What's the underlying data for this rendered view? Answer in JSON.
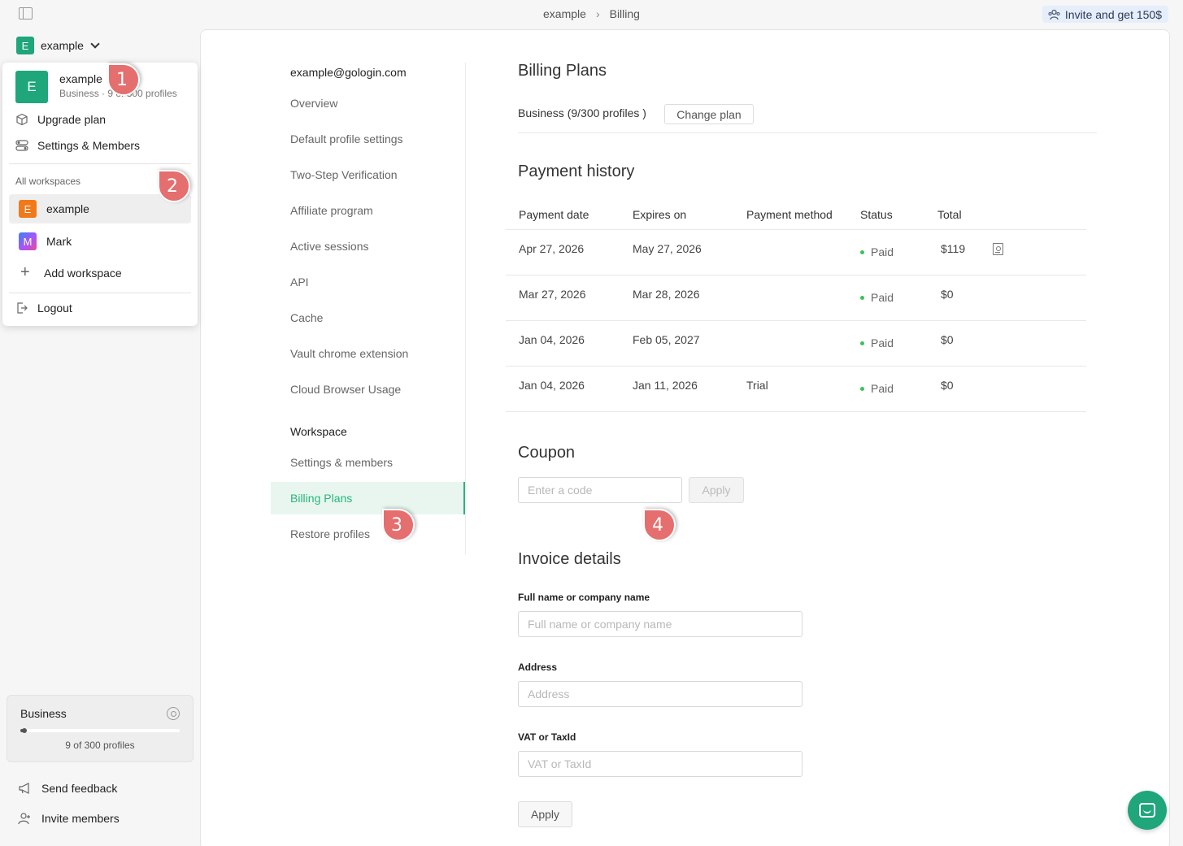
{
  "topbar": {
    "breadcrumb": [
      "example",
      "Billing"
    ],
    "invite_label": "Invite and get 150$"
  },
  "workspace": {
    "current_name": "example",
    "current_initial": "E"
  },
  "dropdown": {
    "header": {
      "initial": "E",
      "name": "example",
      "subtitle": "Business · 9 of 300 profiles"
    },
    "upgrade_label": "Upgrade plan",
    "settings_label": "Settings & Members",
    "section_title": "All workspaces",
    "workspaces": [
      {
        "initial": "E",
        "name": "example",
        "color": "#f07a1a"
      },
      {
        "initial": "M",
        "name": "Mark",
        "color": "gradient"
      }
    ],
    "add_label": "Add workspace",
    "logout_label": "Logout"
  },
  "plan_box": {
    "title": "Business",
    "count_label": "9 of 300 profiles",
    "progress": 0.03
  },
  "sidebar_links": {
    "feedback_label": "Send feedback",
    "invite_label": "Invite members"
  },
  "settings_nav": {
    "email": "example@gologin.com",
    "items": [
      "Overview",
      "Default profile settings",
      "Two-Step Verification",
      "Affiliate program",
      "Active sessions",
      "API",
      "Cache",
      "Vault chrome extension",
      "Cloud Browser Usage"
    ],
    "workspace_section": "Workspace",
    "workspace_items": [
      "Settings & members",
      "Billing Plans",
      "Restore profiles"
    ]
  },
  "billing": {
    "title": "Billing Plans",
    "plan_text": "Business (9/300 profiles )",
    "change_plan_label": "Change plan",
    "history_title": "Payment history",
    "columns": [
      "Payment date",
      "Expires on",
      "Payment method",
      "Status",
      "Total"
    ],
    "rows": [
      {
        "date": "Apr 27, 2026",
        "expires": "May 27, 2026",
        "method": "",
        "status": "Paid",
        "total": "$119",
        "receipt": true
      },
      {
        "date": "Mar 27, 2026",
        "expires": "Mar 28, 2026",
        "method": "",
        "status": "Paid",
        "total": "$0",
        "receipt": false
      },
      {
        "date": "Jan 04, 2026",
        "expires": "Feb 05, 2027",
        "method": "",
        "status": "Paid",
        "total": "$0",
        "receipt": false
      },
      {
        "date": "Jan 04, 2026",
        "expires": "Jan 11, 2026",
        "method": "Trial",
        "status": "Paid",
        "total": "$0",
        "receipt": false
      }
    ],
    "coupon_title": "Coupon",
    "coupon_placeholder": "Enter a code",
    "coupon_apply": "Apply",
    "invoice_title": "Invoice details",
    "fields": [
      {
        "label": "Full name or company name",
        "placeholder": "Full name or company name"
      },
      {
        "label": "Address",
        "placeholder": "Address"
      },
      {
        "label": "VAT or TaxId",
        "placeholder": "VAT or TaxId"
      }
    ],
    "invoice_apply": "Apply"
  },
  "markers": [
    "1",
    "2",
    "3",
    "4"
  ],
  "colors": {
    "accent": "#27b57a",
    "marker": "#e56e6e",
    "paid_dot": "#3fbf5e"
  }
}
